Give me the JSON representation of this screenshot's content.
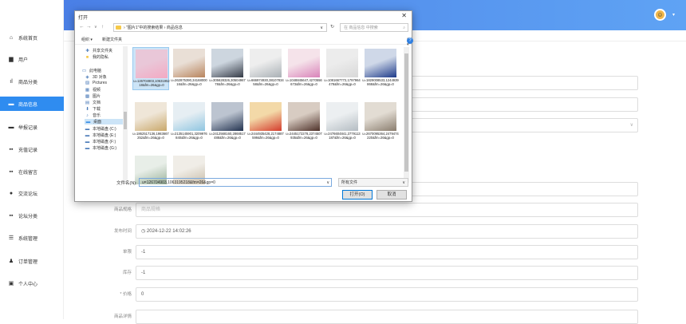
{
  "sidebar": {
    "items": [
      {
        "icon": "home-icon",
        "glyph": "⌂",
        "label": "系统首页"
      },
      {
        "icon": "user-icon",
        "glyph": "▆",
        "label": "用户"
      },
      {
        "icon": "bar-chart-icon",
        "glyph": "ıl",
        "label": "商品分类"
      },
      {
        "icon": "list-icon",
        "glyph": "▬",
        "label": "商品信息"
      },
      {
        "icon": "list-icon",
        "glyph": "▬",
        "label": "举报记录"
      },
      {
        "icon": "grid-icon",
        "glyph": "▪▪",
        "label": "充值记录"
      },
      {
        "icon": "grid-icon",
        "glyph": "▪▪",
        "label": "在线留言"
      },
      {
        "icon": "pin-icon",
        "glyph": "●",
        "label": "交流论坛"
      },
      {
        "icon": "grid-icon",
        "glyph": "▪▪",
        "label": "论坛分类"
      },
      {
        "icon": "menu-icon",
        "glyph": "☰",
        "label": "系统管理"
      },
      {
        "icon": "person-icon",
        "glyph": "♟",
        "label": "订单管理"
      },
      {
        "icon": "id-card-icon",
        "glyph": "▣",
        "label": "个人中心"
      }
    ],
    "active_index": 3
  },
  "topbar": {
    "accent": "#4a7fe6",
    "avatar_icon": "avatar-icon",
    "caret": "▾"
  },
  "form": {
    "rows": [
      {
        "label": "商品规格",
        "value": "商品规格",
        "placeholder": true
      },
      {
        "label": "发布时间",
        "value": "◷  2024-12-22 14:02:26",
        "placeholder": false
      },
      {
        "label": "单限",
        "value": "-1",
        "placeholder": false
      },
      {
        "label": "库存",
        "value": "-1",
        "placeholder": false
      },
      {
        "label": "* 价格",
        "value": "0",
        "placeholder": false
      },
      {
        "label": "商品详情",
        "value": "",
        "placeholder": false
      }
    ]
  },
  "dialog": {
    "title": "打开",
    "close_glyph": "✕",
    "nav": {
      "back": "←",
      "forward": "→",
      "recent": "∨",
      "up": "↑"
    },
    "address": "› \"图片1\"中的搜索结果  ›  商品信息",
    "address_dd": "∨",
    "refresh": "↻",
    "search_placeholder": "在 商品信息 中搜索",
    "search_icon": "⌕",
    "toolbar": {
      "organize": "组织 ▾",
      "new_folder": "新建文件夹",
      "view": "▤ ▾",
      "pane": "◫",
      "help": "?"
    },
    "tree": [
      {
        "icon": "share-icon",
        "glyph": "✚",
        "label": "共享文件夹",
        "indent": 1
      },
      {
        "icon": "folder-icon",
        "glyph": "■",
        "label": "我的隐私",
        "indent": 1
      },
      {
        "icon": "computer-icon",
        "glyph": "▭",
        "label": "此电脑",
        "indent": 0
      },
      {
        "icon": "cube-icon",
        "glyph": "◈",
        "label": "3D 对象",
        "indent": 1
      },
      {
        "icon": "pictures-icon",
        "glyph": "▨",
        "label": "Pictures",
        "indent": 1
      },
      {
        "icon": "video-icon",
        "glyph": "▦",
        "label": "视频",
        "indent": 1
      },
      {
        "icon": "image-icon",
        "glyph": "▩",
        "label": "图片",
        "indent": 1
      },
      {
        "icon": "document-icon",
        "glyph": "▤",
        "label": "文档",
        "indent": 1
      },
      {
        "icon": "download-icon",
        "glyph": "⬇",
        "label": "下载",
        "indent": 1
      },
      {
        "icon": "music-icon",
        "glyph": "♪",
        "label": "音乐",
        "indent": 1
      },
      {
        "icon": "desktop-icon",
        "glyph": "▬",
        "label": "桌面",
        "indent": 1
      },
      {
        "icon": "drive-icon",
        "glyph": "▬",
        "label": "本地磁盘 (C:)",
        "indent": 1
      },
      {
        "icon": "drive-icon",
        "glyph": "▬",
        "label": "本地磁盘 (E:)",
        "indent": 1
      },
      {
        "icon": "drive-icon",
        "glyph": "▬",
        "label": "本地磁盘 (F:)",
        "indent": 1
      },
      {
        "icon": "drive-icon",
        "glyph": "▬",
        "label": "本地磁盘 (G:)",
        "indent": 1
      }
    ],
    "tree_selected": 10,
    "files": [
      {
        "caption": "u=126704903,1063195218&fm=26&gp=0",
        "bg": "#e9c7d8",
        "fg": "#f3a9c3",
        "selected": true
      },
      {
        "caption": "u=262875390,3416800016&fm=26&gp=0",
        "bg": "#e9dfd6",
        "fg": "#b8845c",
        "selected": false
      },
      {
        "caption": "u=305628326,3050496778&fm=26&gp=0",
        "bg": "#cdd6df",
        "fg": "#343a46",
        "selected": false
      },
      {
        "caption": "u=666974930,3810783458&fm=26&gp=0",
        "bg": "#eeeeee",
        "fg": "#a9b0b5",
        "selected": false
      },
      {
        "caption": "u=1048845647,4270556673&fm=26&gp=0",
        "bg": "#f5e3ea",
        "fg": "#d983b9",
        "selected": false
      },
      {
        "caption": "u=1081667772,1797964478&fm=26&gp=0",
        "bg": "#ececec",
        "fg": "#d8d8d8",
        "selected": false
      },
      {
        "caption": "u=1829008533,1244939868&fm=26&gp=0",
        "bg": "#cfd8e8",
        "fg": "#1d3a8a",
        "selected": false
      },
      {
        "caption": "u=1862517136,1983667252&fm=26&gp=0",
        "bg": "#efe6d8",
        "fg": "#c9a86a",
        "selected": false
      },
      {
        "caption": "u=2135145901,3209976840&fm=26&gp=0",
        "bg": "#e6eef3",
        "fg": "#8fc5e0",
        "selected": false
      },
      {
        "caption": "u=2412568160,2868517488&fm=26&gp=0",
        "bg": "#bcc4d0",
        "fg": "#22324f",
        "selected": false
      },
      {
        "caption": "u=2444935428,2174887599&fm=26&gp=0",
        "bg": "#f3d9a8",
        "fg": "#d43c2c",
        "selected": false
      },
      {
        "caption": "u=2445172278,2374507935&fm=26&gp=0",
        "bg": "#d8ccc2",
        "fg": "#4d3028",
        "selected": false
      },
      {
        "caption": "u=2476604841,3779113187&fm=26&gp=0",
        "bg": "#eceff1",
        "fg": "#b4bcc2",
        "selected": false
      },
      {
        "caption": "u=2670095364,2479474220&fm=26&gp=0",
        "bg": "#e2dcd3",
        "fg": "#8a7d6e",
        "selected": false
      },
      {
        "caption": "",
        "bg": "#e8eee8",
        "fg": "#9bb39b",
        "selected": false
      },
      {
        "caption": "",
        "bg": "#f0ede7",
        "fg": "#c8bca8",
        "selected": false
      }
    ],
    "filename_label": "文件名(N):",
    "filename_value": "u=126704903,1063195218&fm=26&gp=0",
    "filetype": "所有文件",
    "open_label": "打开(O)",
    "cancel_label": "取消",
    "dd": "∨"
  }
}
